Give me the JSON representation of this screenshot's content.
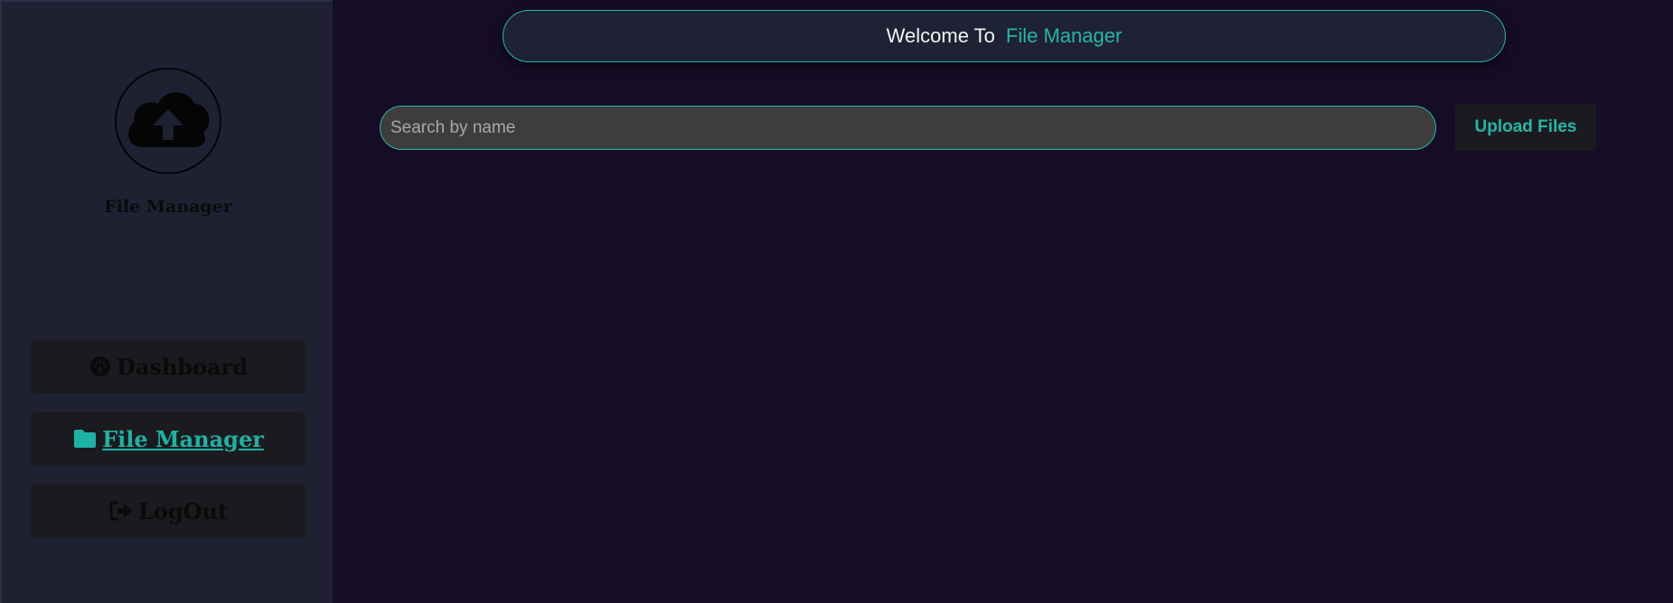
{
  "sidebar": {
    "brand": "File Manager",
    "logo_icon": "cloud-upload-icon",
    "items": [
      {
        "label": "Dashboard",
        "icon": "dashboard-gauge-icon",
        "active": false
      },
      {
        "label": "File Manager",
        "icon": "folder-icon",
        "active": true
      },
      {
        "label": "LogOut",
        "icon": "sign-out-icon",
        "active": false
      }
    ]
  },
  "header": {
    "welcome_prefix": "Welcome To",
    "welcome_app": "File Manager"
  },
  "search": {
    "placeholder": "Search by name",
    "value": ""
  },
  "actions": {
    "upload_label": "Upload Files"
  },
  "colors": {
    "accent": "#23b7a6",
    "background": "#150d26",
    "sidebar": "#1f2133"
  }
}
